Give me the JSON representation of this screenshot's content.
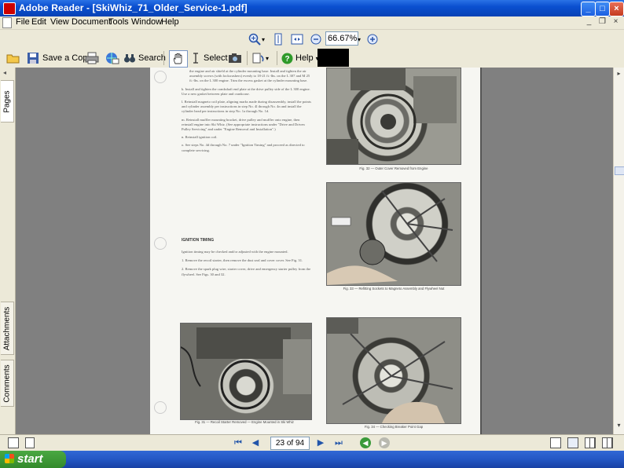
{
  "window": {
    "title": "Adobe Reader - [SkiWhiz_71_Older_Service-1.pdf]",
    "buttons": {
      "minimize": "_",
      "maximize": "□",
      "close": "×"
    }
  },
  "menu": {
    "items": [
      "File",
      "Edit",
      "View",
      "Document",
      "Tools",
      "Window",
      "Help"
    ]
  },
  "toolbar": {
    "zoom_value": "66.67%",
    "save_copy_label": "Save a Copy",
    "search_label": "Search",
    "select_label": "Select",
    "help_label": "Help"
  },
  "side_tabs": {
    "pages": "Pages",
    "attachments": "Attachments",
    "comments": "Comments"
  },
  "navigation": {
    "page_indicator": "23 of 94"
  },
  "document": {
    "left_column_text": [
      "the engine and air shield at the cylinder mounting base. Install and tighten the air assembly screws (with lockwashers) evenly to 18-21 ft.-lbs. on the L 307 and M 25 ft.-lbs. on the L 300 engine. Trim the excess gasket at the cylinder mounting base.",
      "k. Install and tighten the crankshaft end plate at the drive pulley side of the L 300 engine. Use a new gasket between plate and crankcase.",
      "l. Reinstall magneto coil plate, aligning marks made during disassembly, install the points and cylinder assembly per instructions in step No. 4l through No. 4n and install the cylinder head per instructions in step No. 1a through No. 1d.",
      "m. Reinstall muffler mounting bracket, drive pulley and muffler onto engine, then reinstall engine into Ski Whiz. (See appropriate instructions under \"Drive and Driven Pulley Servicing\" and under \"Engine Removal and Installation\".)",
      "n. Reinstall ignition coil.",
      "o. See steps No. 4d through No. 7 under \"Ignition Timing\" and proceed as directed to complete servicing."
    ],
    "section_heading": "IGNITION TIMING",
    "section_text": [
      "Ignition timing may be checked and/or adjusted with the engine mounted.",
      "1. Remove the recoil starter, then remove the dust seal and cover cover. See Fig. 31.",
      "2. Remove the spark plug wire, starter cover, drive and emergency starter pulley from the flywheel. See Figs. 30 and 32."
    ],
    "captions": {
      "fig32": "Fig. 32 — Outer Cover Removed from Engine",
      "fig33": "Fig. 33 — Refitting Sockets to Magneto Assembly and Flywheel Nut",
      "fig31": "Fig. 31 — Recoil Starter Removed — Engine Mounted in Ski Whiz",
      "fig34": "Fig. 34 — Checking Breaker Point Gap"
    }
  },
  "taskbar": {
    "start_label": "start"
  }
}
